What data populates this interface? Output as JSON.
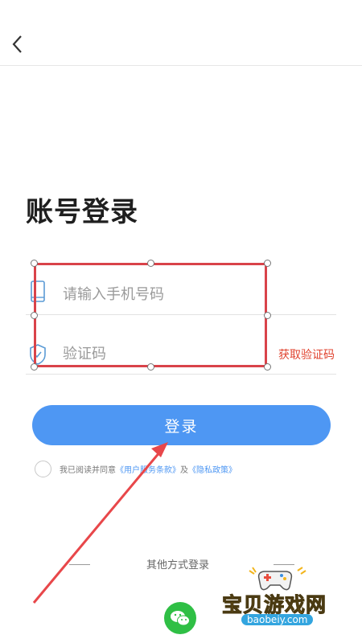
{
  "header": {
    "back_icon": "chevron-left-icon"
  },
  "title": "账号登录",
  "form": {
    "phone_placeholder": "请输入手机号码",
    "phone_icon": "phone-icon",
    "code_placeholder": "验证码",
    "code_icon": "shield-icon",
    "get_code_label": "获取验证码"
  },
  "login_button": "登录",
  "agreement": {
    "prefix": "我已阅读并同意",
    "terms_link": "《用户服务条款》",
    "and": "及",
    "privacy_link": "《隐私政策》"
  },
  "other_login": {
    "label": "其他方式登录",
    "wechat_icon": "wechat-icon"
  },
  "watermark": {
    "text": "宝贝游戏网",
    "url": "baobeiy.com"
  },
  "colors": {
    "accent": "#4e97f3",
    "warning": "#e0432f",
    "annotation": "#d9434a",
    "wechat": "#2fbf45"
  }
}
